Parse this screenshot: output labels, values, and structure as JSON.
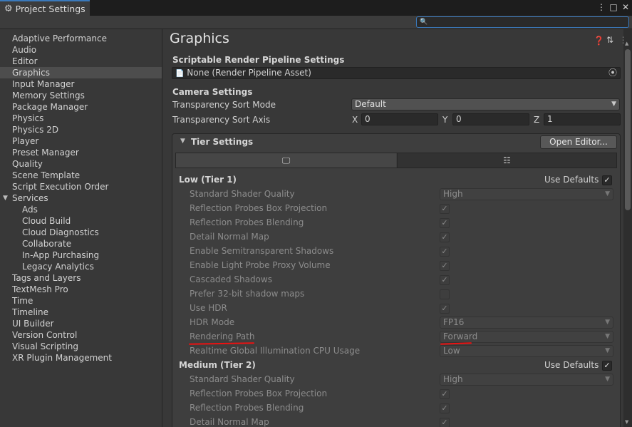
{
  "window": {
    "tab_title": "Project Settings",
    "tab_icon": "gear-icon",
    "controls": [
      "⋮",
      "□",
      "✕"
    ]
  },
  "search": {
    "placeholder": "",
    "value": ""
  },
  "sidebar": {
    "items": [
      {
        "label": "Adaptive Performance",
        "indent": 0
      },
      {
        "label": "Audio",
        "indent": 0
      },
      {
        "label": "Editor",
        "indent": 0
      },
      {
        "label": "Graphics",
        "indent": 0,
        "selected": true
      },
      {
        "label": "Input Manager",
        "indent": 0
      },
      {
        "label": "Memory Settings",
        "indent": 0
      },
      {
        "label": "Package Manager",
        "indent": 0
      },
      {
        "label": "Physics",
        "indent": 0
      },
      {
        "label": "Physics 2D",
        "indent": 0
      },
      {
        "label": "Player",
        "indent": 0
      },
      {
        "label": "Preset Manager",
        "indent": 0
      },
      {
        "label": "Quality",
        "indent": 0
      },
      {
        "label": "Scene Template",
        "indent": 0
      },
      {
        "label": "Script Execution Order",
        "indent": 0
      },
      {
        "label": "Services",
        "indent": 0,
        "expanded": true
      },
      {
        "label": "Ads",
        "indent": 1
      },
      {
        "label": "Cloud Build",
        "indent": 1
      },
      {
        "label": "Cloud Diagnostics",
        "indent": 1
      },
      {
        "label": "Collaborate",
        "indent": 1
      },
      {
        "label": "In-App Purchasing",
        "indent": 1
      },
      {
        "label": "Legacy Analytics",
        "indent": 1
      },
      {
        "label": "Tags and Layers",
        "indent": 0
      },
      {
        "label": "TextMesh Pro",
        "indent": 0
      },
      {
        "label": "Time",
        "indent": 0
      },
      {
        "label": "Timeline",
        "indent": 0
      },
      {
        "label": "UI Builder",
        "indent": 0
      },
      {
        "label": "Version Control",
        "indent": 0
      },
      {
        "label": "Visual Scripting",
        "indent": 0
      },
      {
        "label": "XR Plugin Management",
        "indent": 0
      }
    ]
  },
  "main": {
    "title": "Graphics",
    "header_icons": [
      "help-icon",
      "preset-icon",
      "menu-icon"
    ],
    "srp": {
      "heading": "Scriptable Render Pipeline Settings",
      "value": "None (Render Pipeline Asset)"
    },
    "camera": {
      "heading": "Camera Settings",
      "sort_mode_label": "Transparency Sort Mode",
      "sort_mode_value": "Default",
      "sort_axis_label": "Transparency Sort Axis",
      "axis": {
        "x_label": "X",
        "x": "0",
        "y_label": "Y",
        "y": "0",
        "z_label": "Z",
        "z": "1"
      }
    },
    "tier_settings": {
      "heading": "Tier Settings",
      "open_editor": "Open Editor...",
      "tab_icons": [
        "monitor-icon",
        "server-icon"
      ],
      "use_defaults_label": "Use Defaults",
      "tiers": [
        {
          "name": "Low (Tier 1)",
          "use_defaults": true,
          "rows": [
            {
              "label": "Standard Shader Quality",
              "kind": "dropdown",
              "value": "High"
            },
            {
              "label": "Reflection Probes Box Projection",
              "kind": "check",
              "checked": true
            },
            {
              "label": "Reflection Probes Blending",
              "kind": "check",
              "checked": true
            },
            {
              "label": "Detail Normal Map",
              "kind": "check",
              "checked": true
            },
            {
              "label": "Enable Semitransparent Shadows",
              "kind": "check",
              "checked": true
            },
            {
              "label": "Enable Light Probe Proxy Volume",
              "kind": "check",
              "checked": true
            },
            {
              "label": "Cascaded Shadows",
              "kind": "check",
              "checked": true
            },
            {
              "label": "Prefer 32-bit shadow maps",
              "kind": "check",
              "checked": false
            },
            {
              "label": "Use HDR",
              "kind": "check",
              "checked": true
            },
            {
              "label": "HDR Mode",
              "kind": "dropdown",
              "value": "FP16"
            },
            {
              "label": "Rendering Path",
              "kind": "dropdown",
              "value": "Forward",
              "highlighted": true
            },
            {
              "label": "Realtime Global Illumination CPU Usage",
              "kind": "dropdown",
              "value": "Low"
            }
          ]
        },
        {
          "name": "Medium (Tier 2)",
          "use_defaults": true,
          "rows": [
            {
              "label": "Standard Shader Quality",
              "kind": "dropdown",
              "value": "High"
            },
            {
              "label": "Reflection Probes Box Projection",
              "kind": "check",
              "checked": true
            },
            {
              "label": "Reflection Probes Blending",
              "kind": "check",
              "checked": true
            },
            {
              "label": "Detail Normal Map",
              "kind": "check",
              "checked": true
            }
          ]
        }
      ]
    }
  },
  "colors": {
    "accent": "#3a79bb",
    "highlight_underline": "#ee1111"
  }
}
